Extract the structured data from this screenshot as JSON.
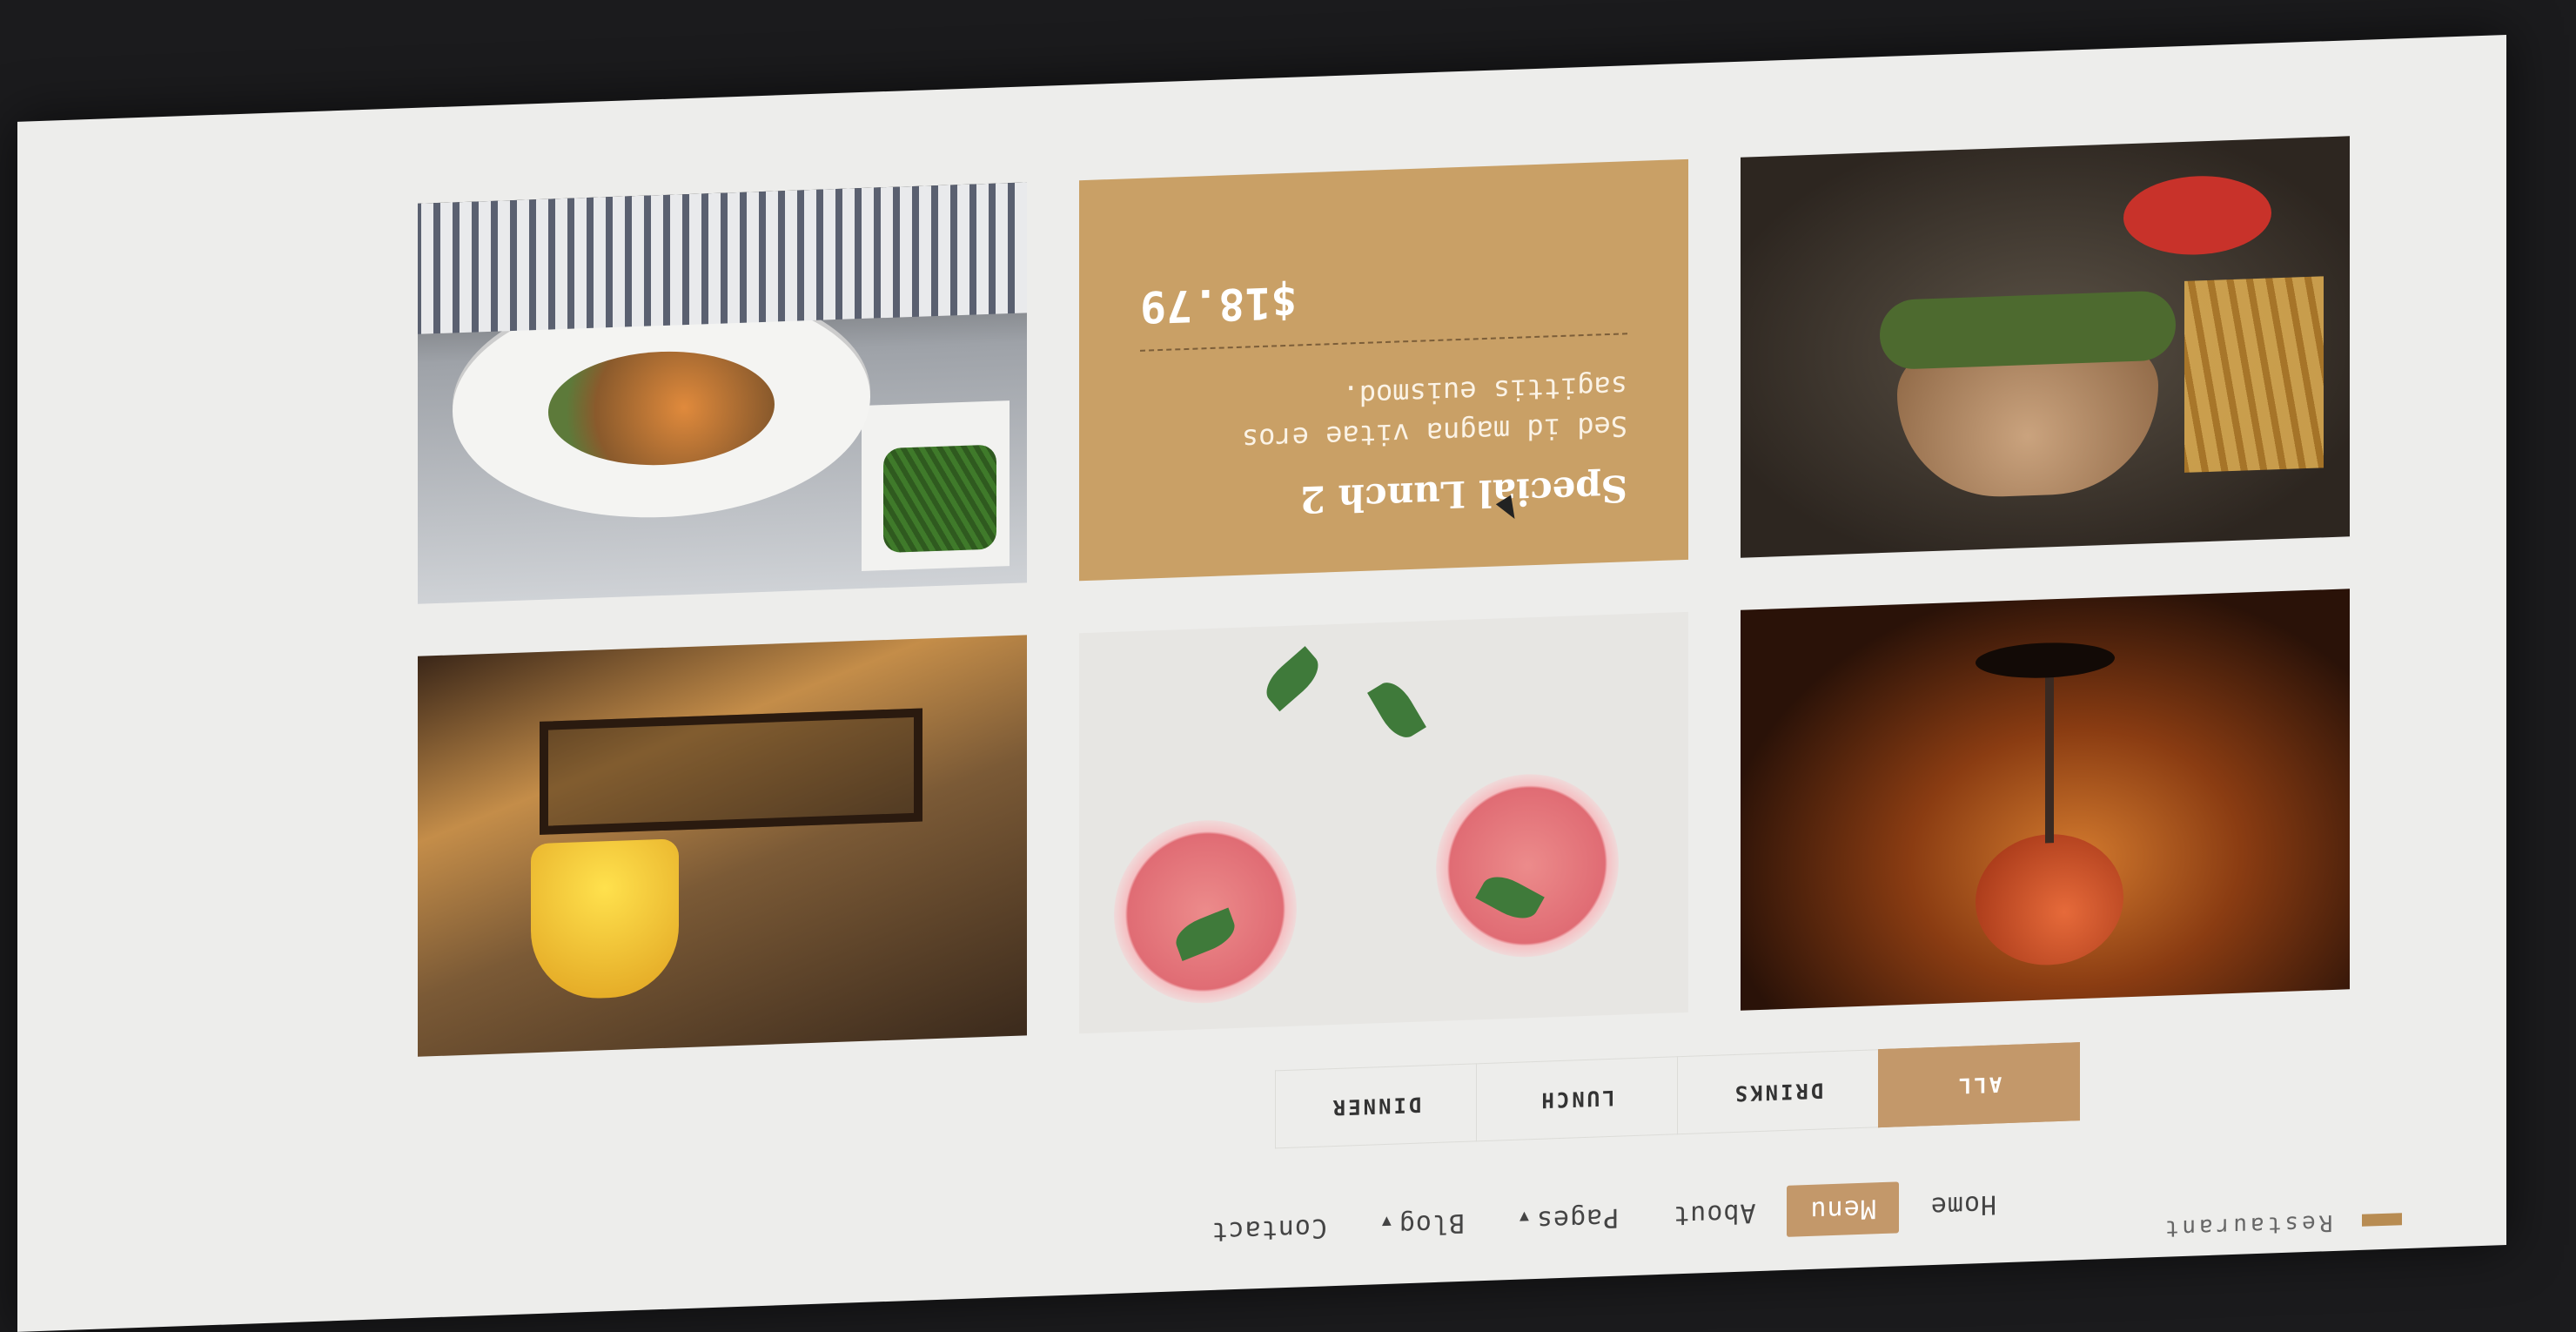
{
  "brand": {
    "name": "Restaurant"
  },
  "nav": {
    "home": "Home",
    "menu": "Menu",
    "about": "About",
    "pages": "Pages",
    "blog": "Blog",
    "contact": "Contact",
    "active": "Menu"
  },
  "filters": {
    "all": "ALL",
    "drinks": "DRINKS",
    "lunch": "LUNCH",
    "dinner": "DINNER",
    "active": "ALL"
  },
  "special": {
    "title": "Special Lunch 2",
    "description": "Sed id magna vitae eros sagittis euismod.",
    "price": "$18.79"
  },
  "icons": {
    "dropdown": "caret-down-icon",
    "cursor": "mouse-pointer-icon"
  },
  "colors": {
    "accent": "#c3986a",
    "card": "#c9a066",
    "page_background": "#ededeb"
  }
}
